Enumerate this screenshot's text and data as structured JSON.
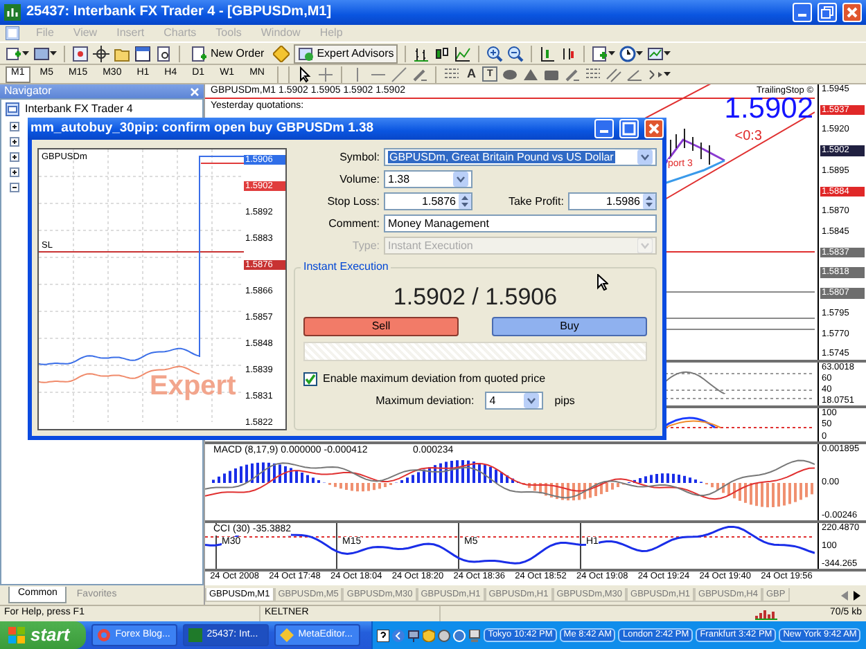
{
  "window": {
    "title": "25437: Interbank FX Trader 4 - [GBPUSDm,M1]"
  },
  "menu": [
    {
      "label": "File",
      "disabled": true
    },
    {
      "label": "View",
      "disabled": true
    },
    {
      "label": "Insert",
      "disabled": true
    },
    {
      "label": "Charts",
      "disabled": true
    },
    {
      "label": "Tools",
      "disabled": true
    },
    {
      "label": "Window",
      "disabled": true
    },
    {
      "label": "Help",
      "disabled": true
    }
  ],
  "toolbar": {
    "buttons": [
      "New Order",
      "Expert Advisors"
    ]
  },
  "timeframes": [
    {
      "label": "M1",
      "selected": true
    },
    {
      "label": "M5",
      "selected": false
    },
    {
      "label": "M15",
      "selected": false
    },
    {
      "label": "M30",
      "selected": false
    },
    {
      "label": "H1",
      "selected": false
    },
    {
      "label": "H4",
      "selected": false
    },
    {
      "label": "D1",
      "selected": false
    },
    {
      "label": "W1",
      "selected": false
    },
    {
      "label": "MN",
      "selected": false
    }
  ],
  "drawing_tools": [
    "A",
    "T"
  ],
  "navigator": {
    "title": "Navigator",
    "items": [
      "Interbank FX Trader 4"
    ],
    "tabs": [
      {
        "label": "Common",
        "selected": true
      },
      {
        "label": "Favorites",
        "selected": false
      }
    ]
  },
  "chart": {
    "header": "GBPUSDm,M1  1.5902 1.5905 1.5902 1.5902",
    "yesterday": "Yesterday quotations:",
    "expert_label": "TrailingStop ©",
    "big_price": "1.5902",
    "signal": "<0:3",
    "support": "port 3",
    "price_axis": [
      {
        "label": "1.5945"
      },
      {
        "label": "1.5937",
        "color": "#e02828"
      },
      {
        "label": "1.5920"
      },
      {
        "label": "1.5902",
        "color": "#202040"
      },
      {
        "label": "1.5895"
      },
      {
        "label": "1.5884",
        "color": "#e02828"
      },
      {
        "label": "1.5870"
      },
      {
        "label": "1.5845"
      },
      {
        "label": "1.5837",
        "color": "#6e6e6e"
      },
      {
        "label": "1.5818",
        "color": "#6e6e6e"
      },
      {
        "label": "1.5807",
        "color": "#6e6e6e"
      },
      {
        "label": "1.5795"
      },
      {
        "label": "1.5770"
      },
      {
        "label": "1.5745"
      }
    ],
    "indicators": [
      {
        "kind": "oscillator",
        "axis": [
          "63.0018",
          "60",
          "40",
          "18.0751"
        ]
      },
      {
        "kind": "stochastic",
        "axis": [
          "100",
          "50",
          "0"
        ]
      },
      {
        "kind": "macd",
        "label": "MACD (8,17,9) 0.000000 -0.000412",
        "value": "0.000234",
        "axis": [
          "0.001895",
          "0.00",
          "-0.00246"
        ]
      },
      {
        "kind": "cci",
        "label": "CCI (30) -35.3882",
        "marks": [
          "M30",
          "M15",
          "M5",
          "H1"
        ],
        "axis": [
          "220.4870",
          "100",
          "-344.265"
        ]
      }
    ],
    "time_axis": [
      "24 Oct 2008",
      "24 Oct 17:48",
      "24 Oct 18:04",
      "24 Oct 18:20",
      "24 Oct 18:36",
      "24 Oct 18:52",
      "24 Oct 19:08",
      "24 Oct 19:24",
      "24 Oct 19:40",
      "24 Oct 19:56"
    ],
    "tabs": [
      {
        "label": "GBPUSDm,M1",
        "selected": true
      },
      {
        "label": "GBPUSDm,M5",
        "selected": false
      },
      {
        "label": "GBPUSDm,M30",
        "selected": false
      },
      {
        "label": "GBPUSDm,H1",
        "selected": false
      },
      {
        "label": "GBPUSDm,H1",
        "selected": false
      },
      {
        "label": "GBPUSDm,M30",
        "selected": false
      },
      {
        "label": "GBPUSDm,H1",
        "selected": false
      },
      {
        "label": "GBPUSDm,H4",
        "selected": false
      },
      {
        "label": "GBP",
        "selected": false
      }
    ]
  },
  "dialog": {
    "title": "mm_autobuy_30pip: confirm open buy GBPUSDm 1.38",
    "chart": {
      "symbol": "GBPUSDm",
      "sl_label": "SL",
      "watermark": "Expert",
      "axis": [
        {
          "label": "1.5906",
          "color": "#2f6ee8"
        },
        {
          "label": "1.5902",
          "color": "#e03c3c"
        },
        {
          "label": "1.5892"
        },
        {
          "label": "1.5883"
        },
        {
          "label": "1.5876",
          "color": "#c83232"
        },
        {
          "label": "1.5866"
        },
        {
          "label": "1.5857"
        },
        {
          "label": "1.5848"
        },
        {
          "label": "1.5839"
        },
        {
          "label": "1.5831"
        },
        {
          "label": "1.5822"
        }
      ]
    },
    "form": {
      "symbol_label": "Symbol:",
      "symbol": "GBPUSDm, Great Britain Pound vs US Dollar",
      "volume_label": "Volume:",
      "volume": "1.38",
      "stop_loss_label": "Stop Loss:",
      "stop_loss": "1.5876",
      "take_profit_label": "Take Profit:",
      "take_profit": "1.5986",
      "comment_label": "Comment:",
      "comment": "Money Management",
      "type_label": "Type:",
      "type": "Instant Execution",
      "type_disabled": true
    },
    "execution": {
      "title": "Instant Execution",
      "quote": "1.5902 / 1.5906",
      "sell": "Sell",
      "buy": "Buy",
      "deviation_enabled": true,
      "deviation_label": "Enable maximum deviation from quoted price",
      "max_label": "Maximum deviation:",
      "max_value": "4",
      "unit": "pips"
    }
  },
  "status_bar": [
    "For Help, press F1",
    "KELTNER",
    "70/5 kb"
  ],
  "taskbar": {
    "start": "start",
    "tasks": [
      {
        "label": "Forex Blog...",
        "selected": false
      },
      {
        "label": "25437: Int...",
        "selected": true
      },
      {
        "label": "MetaEditor...",
        "selected": false
      }
    ],
    "clocks": [
      "Tokyo 10:42 PM",
      "Me 8:42 AM",
      "London 2:42 PM",
      "Frankfurt 3:42 PM",
      "New York 9:42 AM"
    ]
  }
}
